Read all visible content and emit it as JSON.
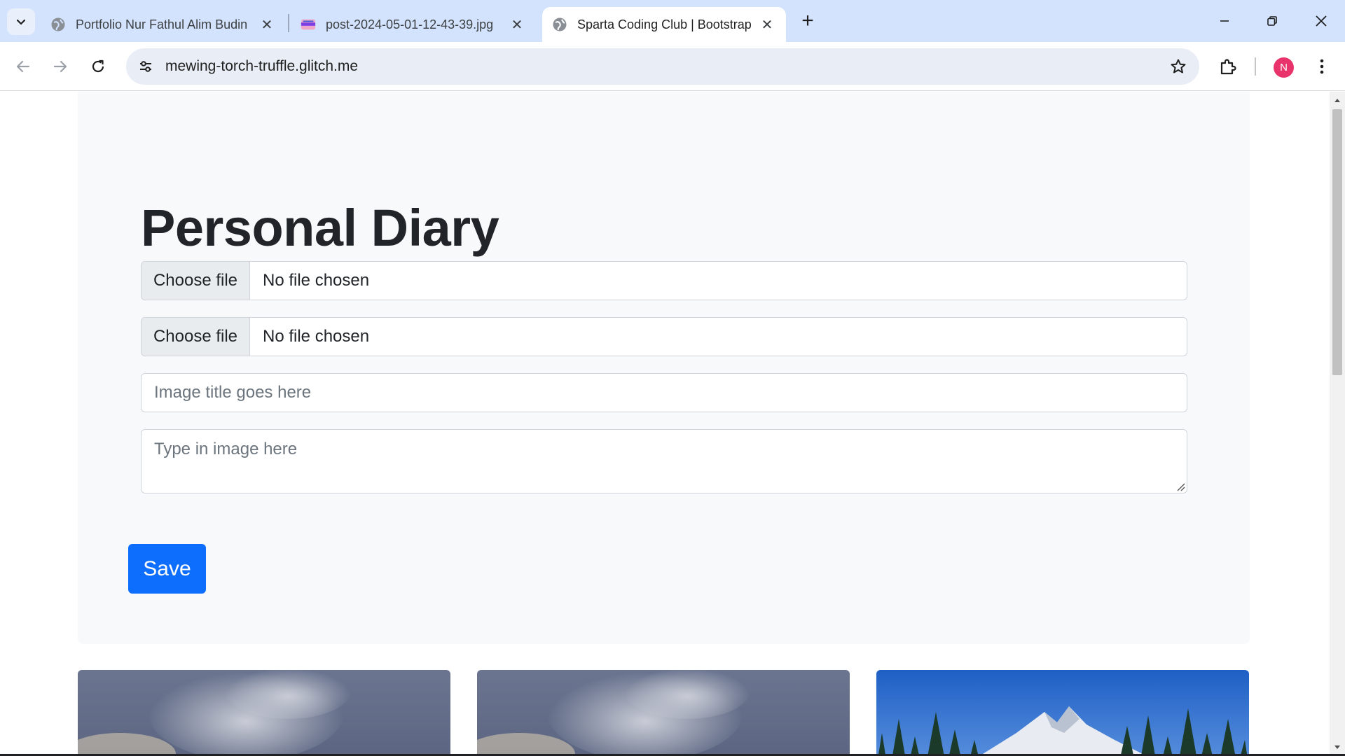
{
  "browser": {
    "tabs": [
      {
        "title": "Portfolio Nur Fathul Alim Budin",
        "favicon": "globe-icon",
        "active": false
      },
      {
        "title": "post-2024-05-01-12-43-39.jpg",
        "favicon": "image-thumbnail-icon",
        "active": false
      },
      {
        "title": "Sparta Coding Club | Bootstrap",
        "favicon": "globe-icon",
        "active": true
      }
    ],
    "url": "mewing-torch-truffle.glitch.me",
    "profile_initial": "N",
    "profile_color": "#e8336b"
  },
  "page": {
    "heading": "Personal Diary",
    "file_inputs": [
      {
        "button_label": "Choose file",
        "status": "No file chosen"
      },
      {
        "button_label": "Choose file",
        "status": "No file chosen"
      }
    ],
    "title_placeholder": "Image title goes here",
    "content_placeholder": "Type in image here",
    "save_label": "Save",
    "accent_color": "#0d6efd",
    "cards": [
      {
        "image": "cloudy-sky-photo"
      },
      {
        "image": "cloudy-sky-photo"
      },
      {
        "image": "snowy-mountain-forest-photo"
      }
    ]
  }
}
